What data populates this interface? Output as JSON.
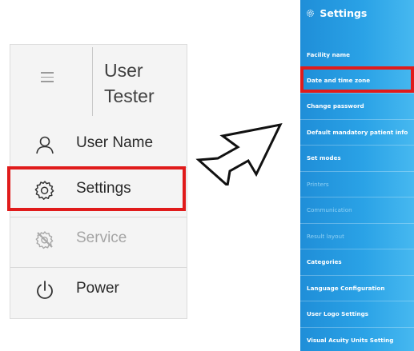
{
  "menu": {
    "user_first": "User",
    "user_last": "Tester",
    "items": [
      {
        "label": "User Name",
        "icon": "user-icon"
      },
      {
        "label": "Settings",
        "icon": "gear-icon"
      },
      {
        "label": "Service",
        "icon": "service-icon"
      },
      {
        "label": "Power",
        "icon": "power-icon"
      }
    ]
  },
  "settings": {
    "title": "Settings",
    "items": [
      {
        "label": "Facility name"
      },
      {
        "label": "Date and time zone"
      },
      {
        "label": "Change password"
      },
      {
        "label": "Default mandatory patient info"
      },
      {
        "label": "Set modes"
      },
      {
        "label": "Printers"
      },
      {
        "label": "Communication"
      },
      {
        "label": "Result layout"
      },
      {
        "label": "Categories"
      },
      {
        "label": "Language Configuration"
      },
      {
        "label": "User Logo Settings"
      },
      {
        "label": "Visual Acuity Units Setting"
      }
    ]
  },
  "colors": {
    "highlight": "#e01b1b",
    "panel_blue": "#2aa2e6",
    "menu_bg": "#f4f4f4"
  }
}
